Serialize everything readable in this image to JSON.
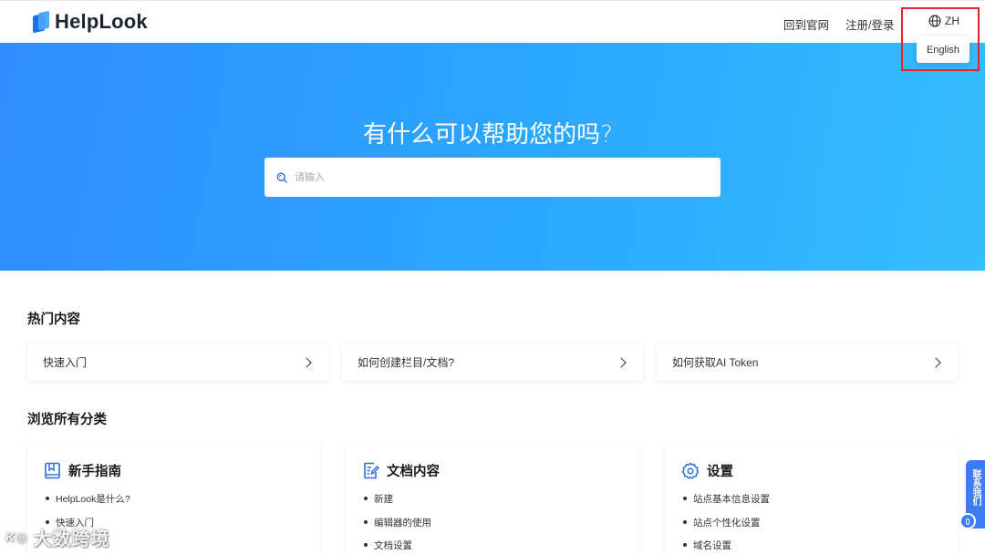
{
  "header": {
    "brand": "HelpLook",
    "nav_home": "回到官网",
    "nav_login": "注册/登录",
    "lang_current": "ZH",
    "lang_option": "English"
  },
  "hero": {
    "title": "有什么可以帮助您的吗?",
    "search_placeholder": "请输入"
  },
  "hot": {
    "title": "热门内容",
    "items": [
      {
        "label": "快速入门"
      },
      {
        "label": "如何创建栏目/文档?"
      },
      {
        "label": "如何获取AI Token"
      }
    ]
  },
  "browse": {
    "title": "浏览所有分类",
    "categories": [
      {
        "title": "新手指南",
        "icon": "book-icon",
        "items": [
          "HelpLook是什么?",
          "快速入门"
        ]
      },
      {
        "title": "文档内容",
        "icon": "document-edit-icon",
        "items": [
          "新建",
          "编辑器的使用",
          "文档设置"
        ]
      },
      {
        "title": "设置",
        "icon": "gear-icon",
        "items": [
          "站点基本信息设置",
          "站点个性化设置",
          "域名设置"
        ]
      }
    ]
  },
  "float": {
    "contact": "联系我们"
  },
  "watermark": {
    "text": "大数跨境"
  },
  "colors": {
    "accent": "#2f8cff",
    "highlight_box": "#e0262d"
  }
}
